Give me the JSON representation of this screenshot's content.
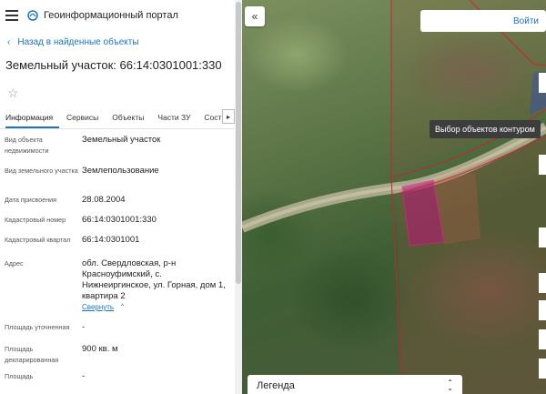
{
  "header": {
    "brand": "Геоинформационный портал"
  },
  "nav": {
    "back_label": "Назад в найденные объекты"
  },
  "object": {
    "title": "Земельный участок: 66:14:0301001:330"
  },
  "tabs": [
    "Информация",
    "Сервисы",
    "Объекты",
    "Части ЗУ",
    "Сост"
  ],
  "active_tab": 0,
  "details": [
    {
      "label": "Вид объекта недвижимости",
      "value": "Земельный участок"
    },
    {
      "label": "Вид земельного участка",
      "value": "Землепользование"
    },
    {
      "label": "Дата присвоения",
      "value": "28.08.2004"
    },
    {
      "label": "Кадастровый номер",
      "value": "66:14:0301001:330"
    },
    {
      "label": "Кадастровый квартал",
      "value": "66:14:0301001"
    },
    {
      "label": "Адрес",
      "value": "обл. Свердловская, р-н Красноуфимский, с. Нижнеиргинское, ул. Горная, дом 1, квартира 2",
      "link": "Свернуть"
    },
    {
      "label": "Площадь уточненная",
      "value": "-"
    },
    {
      "label": "Площадь декларированная",
      "value": "900 кв. м"
    },
    {
      "label": "Площадь",
      "value": "-"
    }
  ],
  "map": {
    "login_label": "Войти",
    "tooltip": "Выбор объектов контуром",
    "legend_label": "Легенда"
  },
  "colors": {
    "accent": "#1a73c8",
    "parcel_border": "#d0202f",
    "selected_parcel": "#c0147a"
  }
}
